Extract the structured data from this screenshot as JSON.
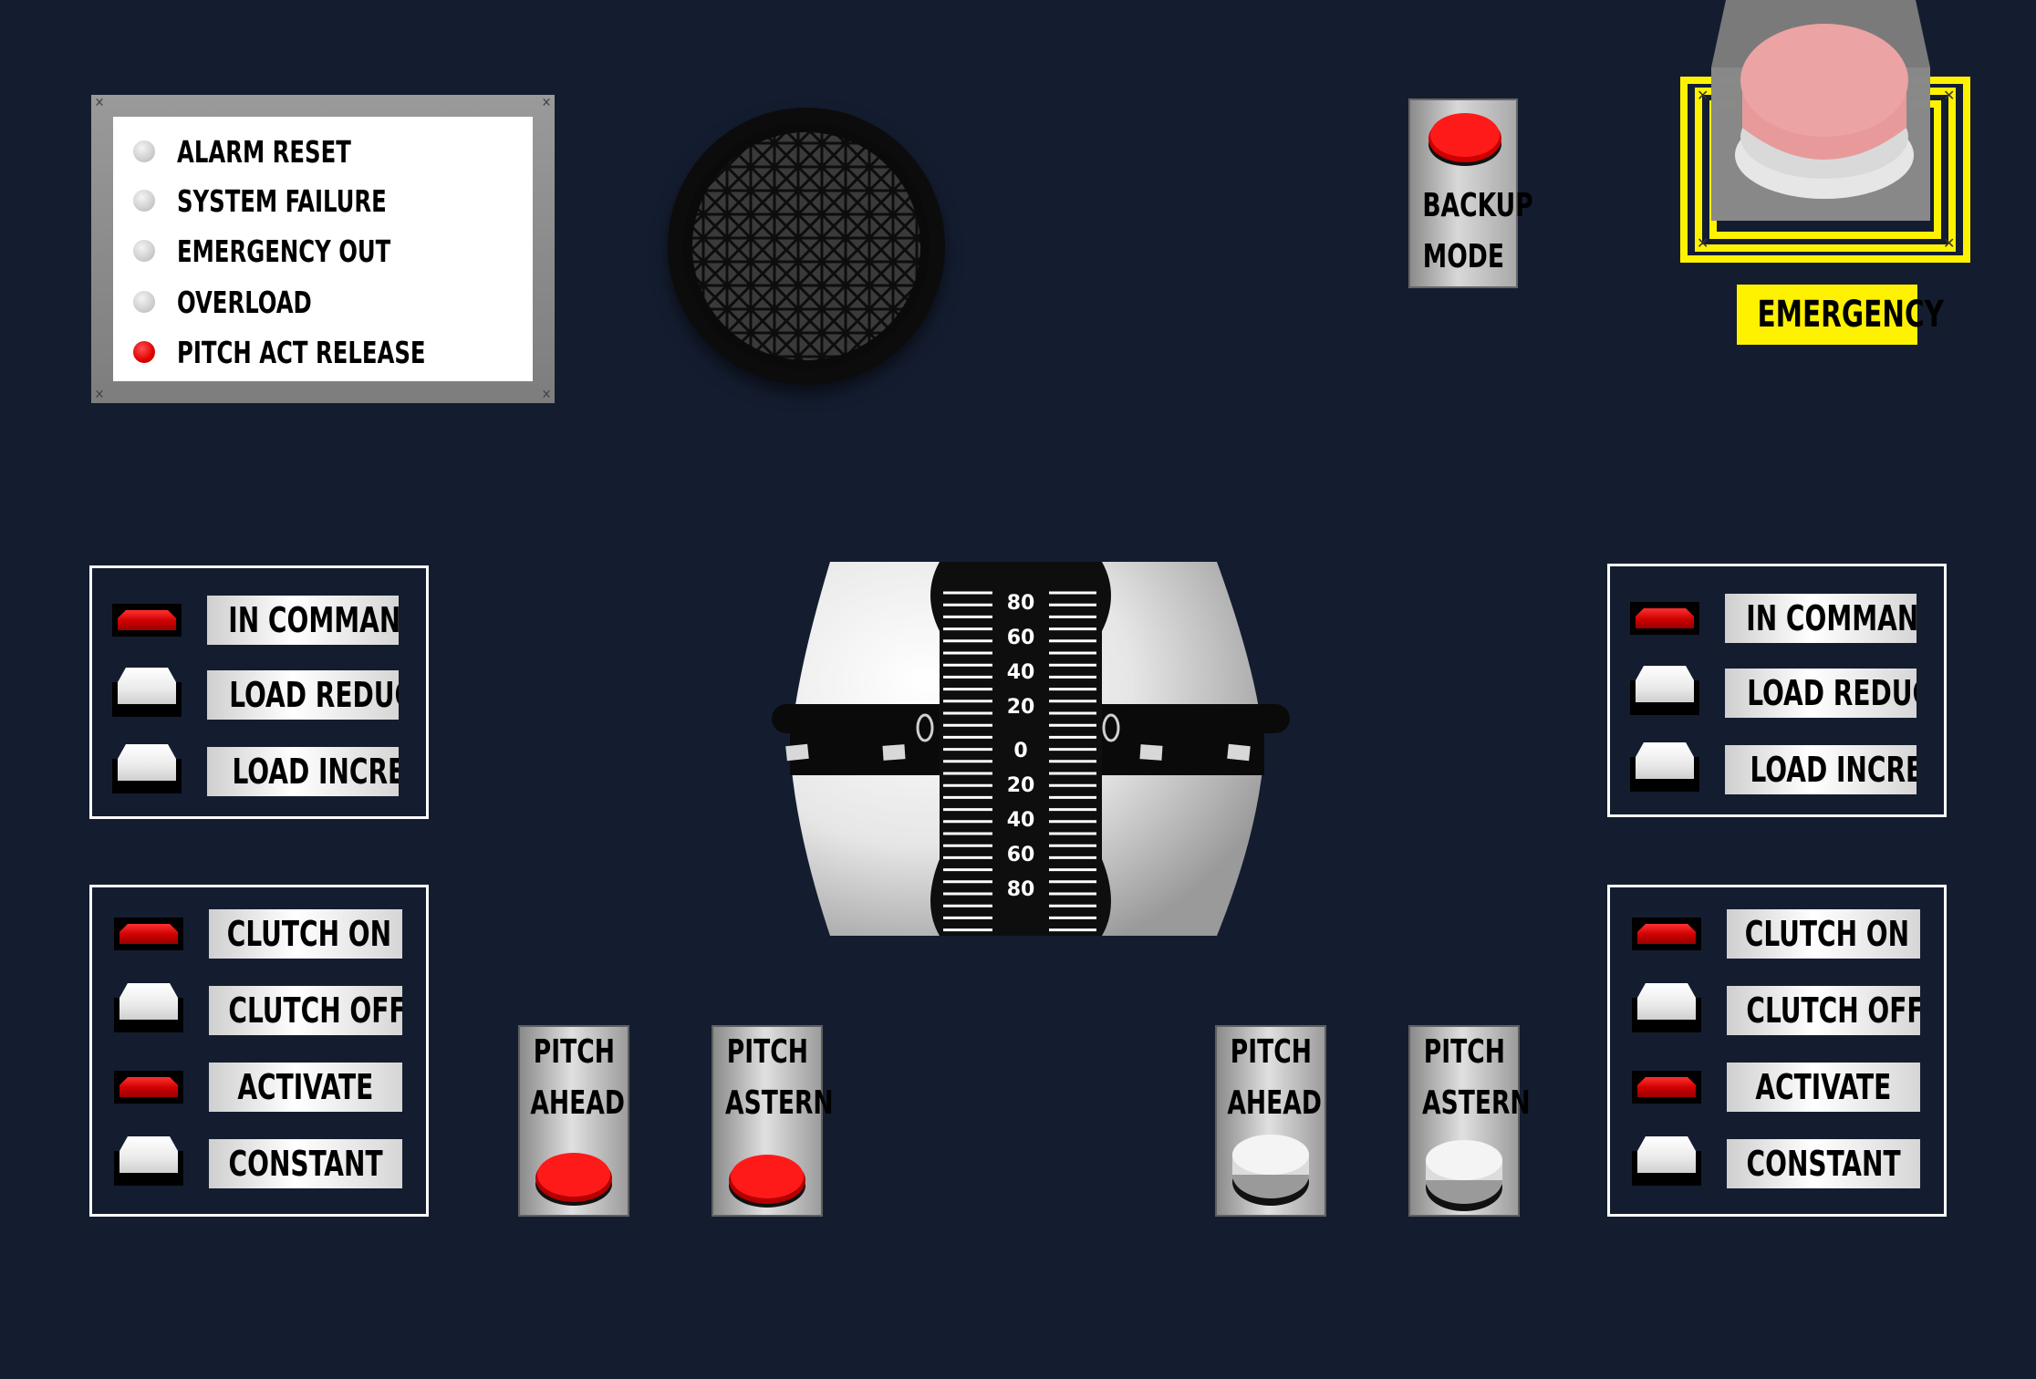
{
  "alarm_panel": {
    "items": [
      {
        "label": "ALARM RESET",
        "state": "off"
      },
      {
        "label": "SYSTEM FAILURE",
        "state": "off"
      },
      {
        "label": "EMERGENCY OUT",
        "state": "off"
      },
      {
        "label": "OVERLOAD",
        "state": "off"
      },
      {
        "label": "PITCH ACT RELEASE",
        "state": "red"
      }
    ]
  },
  "backup": {
    "line1": "BACKUP",
    "line2": "MODE",
    "lamp_color": "#ff0000"
  },
  "emergency": {
    "label": "EMERGENCY",
    "button_color": "#f2a0a0",
    "frame_color": "#fff200"
  },
  "left_command": {
    "items": [
      {
        "label": "IN COMMAND",
        "state": "red"
      },
      {
        "label": "LOAD REDUCE",
        "state": "white"
      },
      {
        "label": "LOAD INCREASE",
        "state": "white"
      }
    ]
  },
  "right_command": {
    "items": [
      {
        "label": "IN COMMAND",
        "state": "red"
      },
      {
        "label": "LOAD REDUCE",
        "state": "white"
      },
      {
        "label": "LOAD INCREASE",
        "state": "white"
      }
    ]
  },
  "left_clutch": {
    "items": [
      {
        "label": "CLUTCH ON",
        "state": "red"
      },
      {
        "label": "CLUTCH OFF",
        "state": "white"
      },
      {
        "label": "ACTIVATE",
        "state": "red"
      },
      {
        "label": "CONSTANT",
        "state": "white"
      }
    ]
  },
  "right_clutch": {
    "items": [
      {
        "label": "CLUTCH ON",
        "state": "red"
      },
      {
        "label": "CLUTCH OFF",
        "state": "white"
      },
      {
        "label": "ACTIVATE",
        "state": "red"
      },
      {
        "label": "CONSTANT",
        "state": "white"
      }
    ]
  },
  "pitch_buttons": [
    {
      "line1": "PITCH",
      "line2": "AHEAD",
      "lamp": "red"
    },
    {
      "line1": "PITCH",
      "line2": "ASTERN",
      "lamp": "red"
    },
    {
      "line1": "PITCH",
      "line2": "AHEAD",
      "lamp": "white"
    },
    {
      "line1": "PITCH",
      "line2": "ASTERN",
      "lamp": "white"
    }
  ],
  "lever": {
    "scale_upper": [
      "80",
      "60",
      "40",
      "20"
    ],
    "zero": "0",
    "scale_lower": [
      "20",
      "40",
      "60",
      "80"
    ],
    "position": 0
  },
  "colors": {
    "background": "#141d30",
    "lamp_red": "#ff0000",
    "lamp_white": "#f0f0f0"
  }
}
